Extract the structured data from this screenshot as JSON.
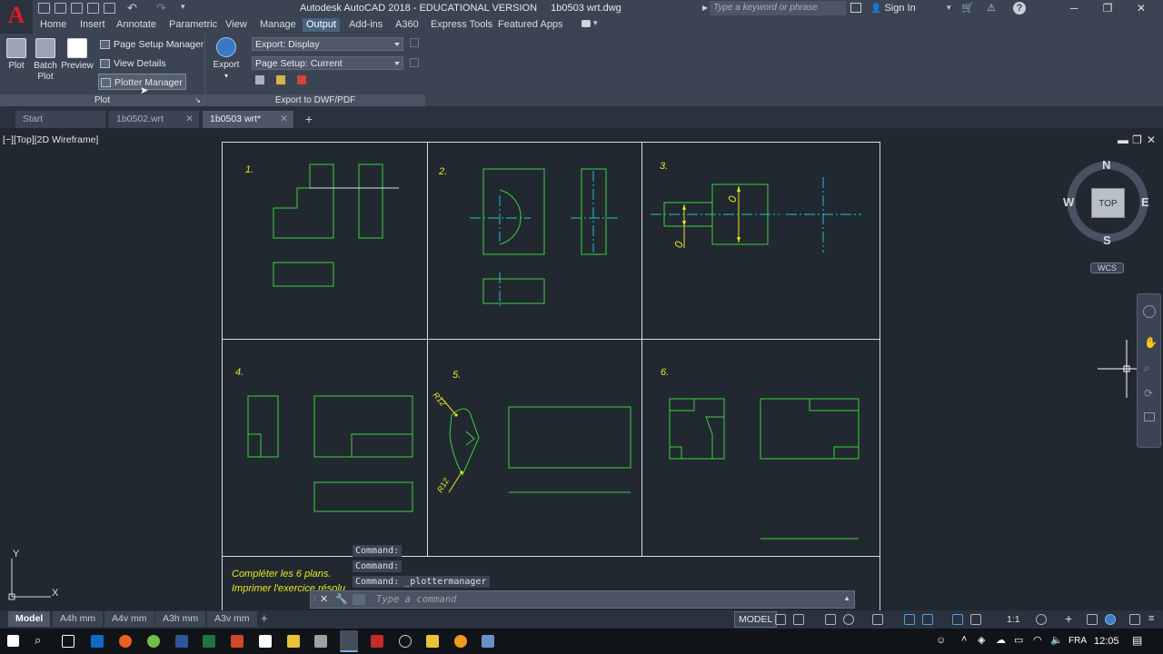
{
  "titlebar": {
    "app_title": "Autodesk AutoCAD 2018 - EDUCATIONAL VERSION",
    "file_name": "1b0503 wrt.dwg",
    "search_placeholder": "Type a keyword or phrase",
    "sign_in": "Sign In",
    "logo": "A"
  },
  "menu": {
    "tabs": [
      "Home",
      "Insert",
      "Annotate",
      "Parametric",
      "View",
      "Manage",
      "Output",
      "Add-ins",
      "A360",
      "Express Tools",
      "Featured Apps"
    ],
    "active": "Output"
  },
  "ribbon": {
    "plot_panel": {
      "title": "Plot",
      "plot": "Plot",
      "batch_plot_1": "Batch",
      "batch_plot_2": "Plot",
      "preview": "Preview",
      "page_setup_manager": "Page Setup Manager",
      "view_details": "View Details",
      "plotter_manager": "Plotter Manager"
    },
    "export_panel": {
      "title": "Export to DWF/PDF",
      "export": "Export",
      "export_display": "Export: Display",
      "page_setup_current": "Page Setup: Current"
    }
  },
  "doc_tabs": [
    {
      "label": "Start",
      "active": false
    },
    {
      "label": "1b0502.wrt",
      "active": false
    },
    {
      "label": "1b0503 wrt*",
      "active": true
    }
  ],
  "viewport": {
    "label": "[−][Top][2D Wireframe]",
    "cube_top": "TOP",
    "north": "N",
    "south": "S",
    "east": "E",
    "west": "W",
    "wcs": "WCS",
    "ucs_x": "X",
    "ucs_y": "Y"
  },
  "drawing": {
    "numbers": [
      "1.",
      "2.",
      "3.",
      "4.",
      "5.",
      "6."
    ],
    "radius_labels": [
      "R12",
      "R12"
    ],
    "instruction_1": "Compléter les 6 plans.",
    "instruction_2": "Imprimer l'exercice résolu",
    "line_color": "#3ecf3e",
    "axis_color": "#1fc2d6",
    "dim_color": "#e8e820",
    "frame_color": "#d9dde2"
  },
  "command": {
    "history": [
      "Command:",
      "Command:",
      "Command:  _plottermanager"
    ],
    "placeholder": "Type a command"
  },
  "status": {
    "layouts": [
      "Model",
      "A4h mm",
      "A4v mm",
      "A3h mm",
      "A3v mm"
    ],
    "active_layout": "Model",
    "model": "MODEL",
    "scale": "1:1"
  },
  "taskbar": {
    "lang": "FRA",
    "time": "12:05"
  }
}
